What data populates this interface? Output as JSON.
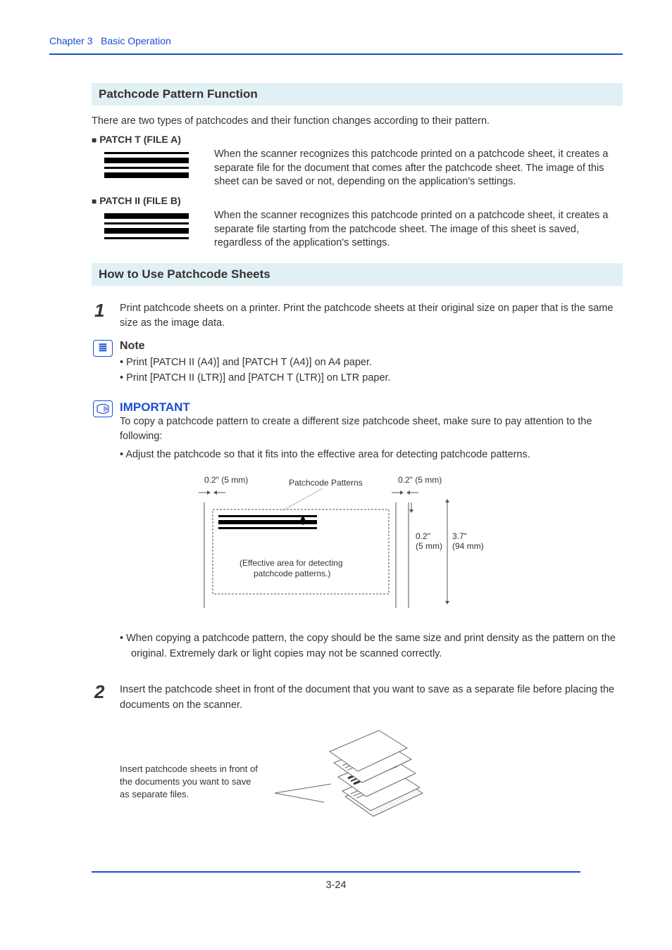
{
  "chapter": {
    "prefix": "Chapter 3",
    "title": "Basic Operation"
  },
  "sections": {
    "s1_title": "Patchcode Pattern Function",
    "s1_intro": "There are two types of patchcodes and their function changes according to their pattern.",
    "patchT_label": "PATCH T (FILE A)",
    "patchT_desc": "When the scanner recognizes this patchcode printed on a patchcode sheet, it creates a separate file for the document that comes after the patchcode sheet. The image of this sheet can be saved or not, depending on the application's settings.",
    "patchII_label": "PATCH II (FILE B)",
    "patchII_desc": "When the scanner recognizes this patchcode printed on a patchcode sheet, it creates a separate file starting from the patchcode sheet. The image of this sheet is saved, regardless of the application's settings.",
    "s2_title": "How to Use Patchcode Sheets"
  },
  "steps": {
    "n1": "1",
    "step1": "Print patchcode sheets on a printer. Print the patchcode sheets at their original size on paper that is the same size as the image data.",
    "n2": "2",
    "step2": "Insert the patchcode sheet in front of the document that you want to save as a separate file before placing the documents on the scanner."
  },
  "note": {
    "title": "Note",
    "b1": "Print [PATCH II (A4)] and [PATCH T (A4)] on A4 paper.",
    "b2": "Print [PATCH II (LTR)] and [PATCH T (LTR)] on LTR paper."
  },
  "important": {
    "title": "IMPORTANT",
    "intro": "To copy a patchcode pattern to create a different size patchcode sheet, make sure to pay attention to the following:",
    "b1": "Adjust the patchcode so that it fits into the effective area for detecting patchcode patterns.",
    "b2": "When copying a patchcode pattern, the copy should be the same size and print density as the pattern on the original. Extremely dark or light copies may not be scanned correctly."
  },
  "diagram": {
    "margin_left": "0.2\" (5 mm)",
    "margin_right": "0.2\" (5 mm)",
    "pattern_label": "Patchcode Patterns",
    "gap_v": "0.2\"",
    "gap_v_mm": "(5 mm)",
    "height": "3.7\"",
    "height_mm": "(94 mm)",
    "area_label1": "(Effective area for detecting",
    "area_label2": "patchcode patterns.)"
  },
  "stack_caption": "Insert patchcode sheets in front of the documents you want to save as separate files.",
  "page_number": "3-24"
}
